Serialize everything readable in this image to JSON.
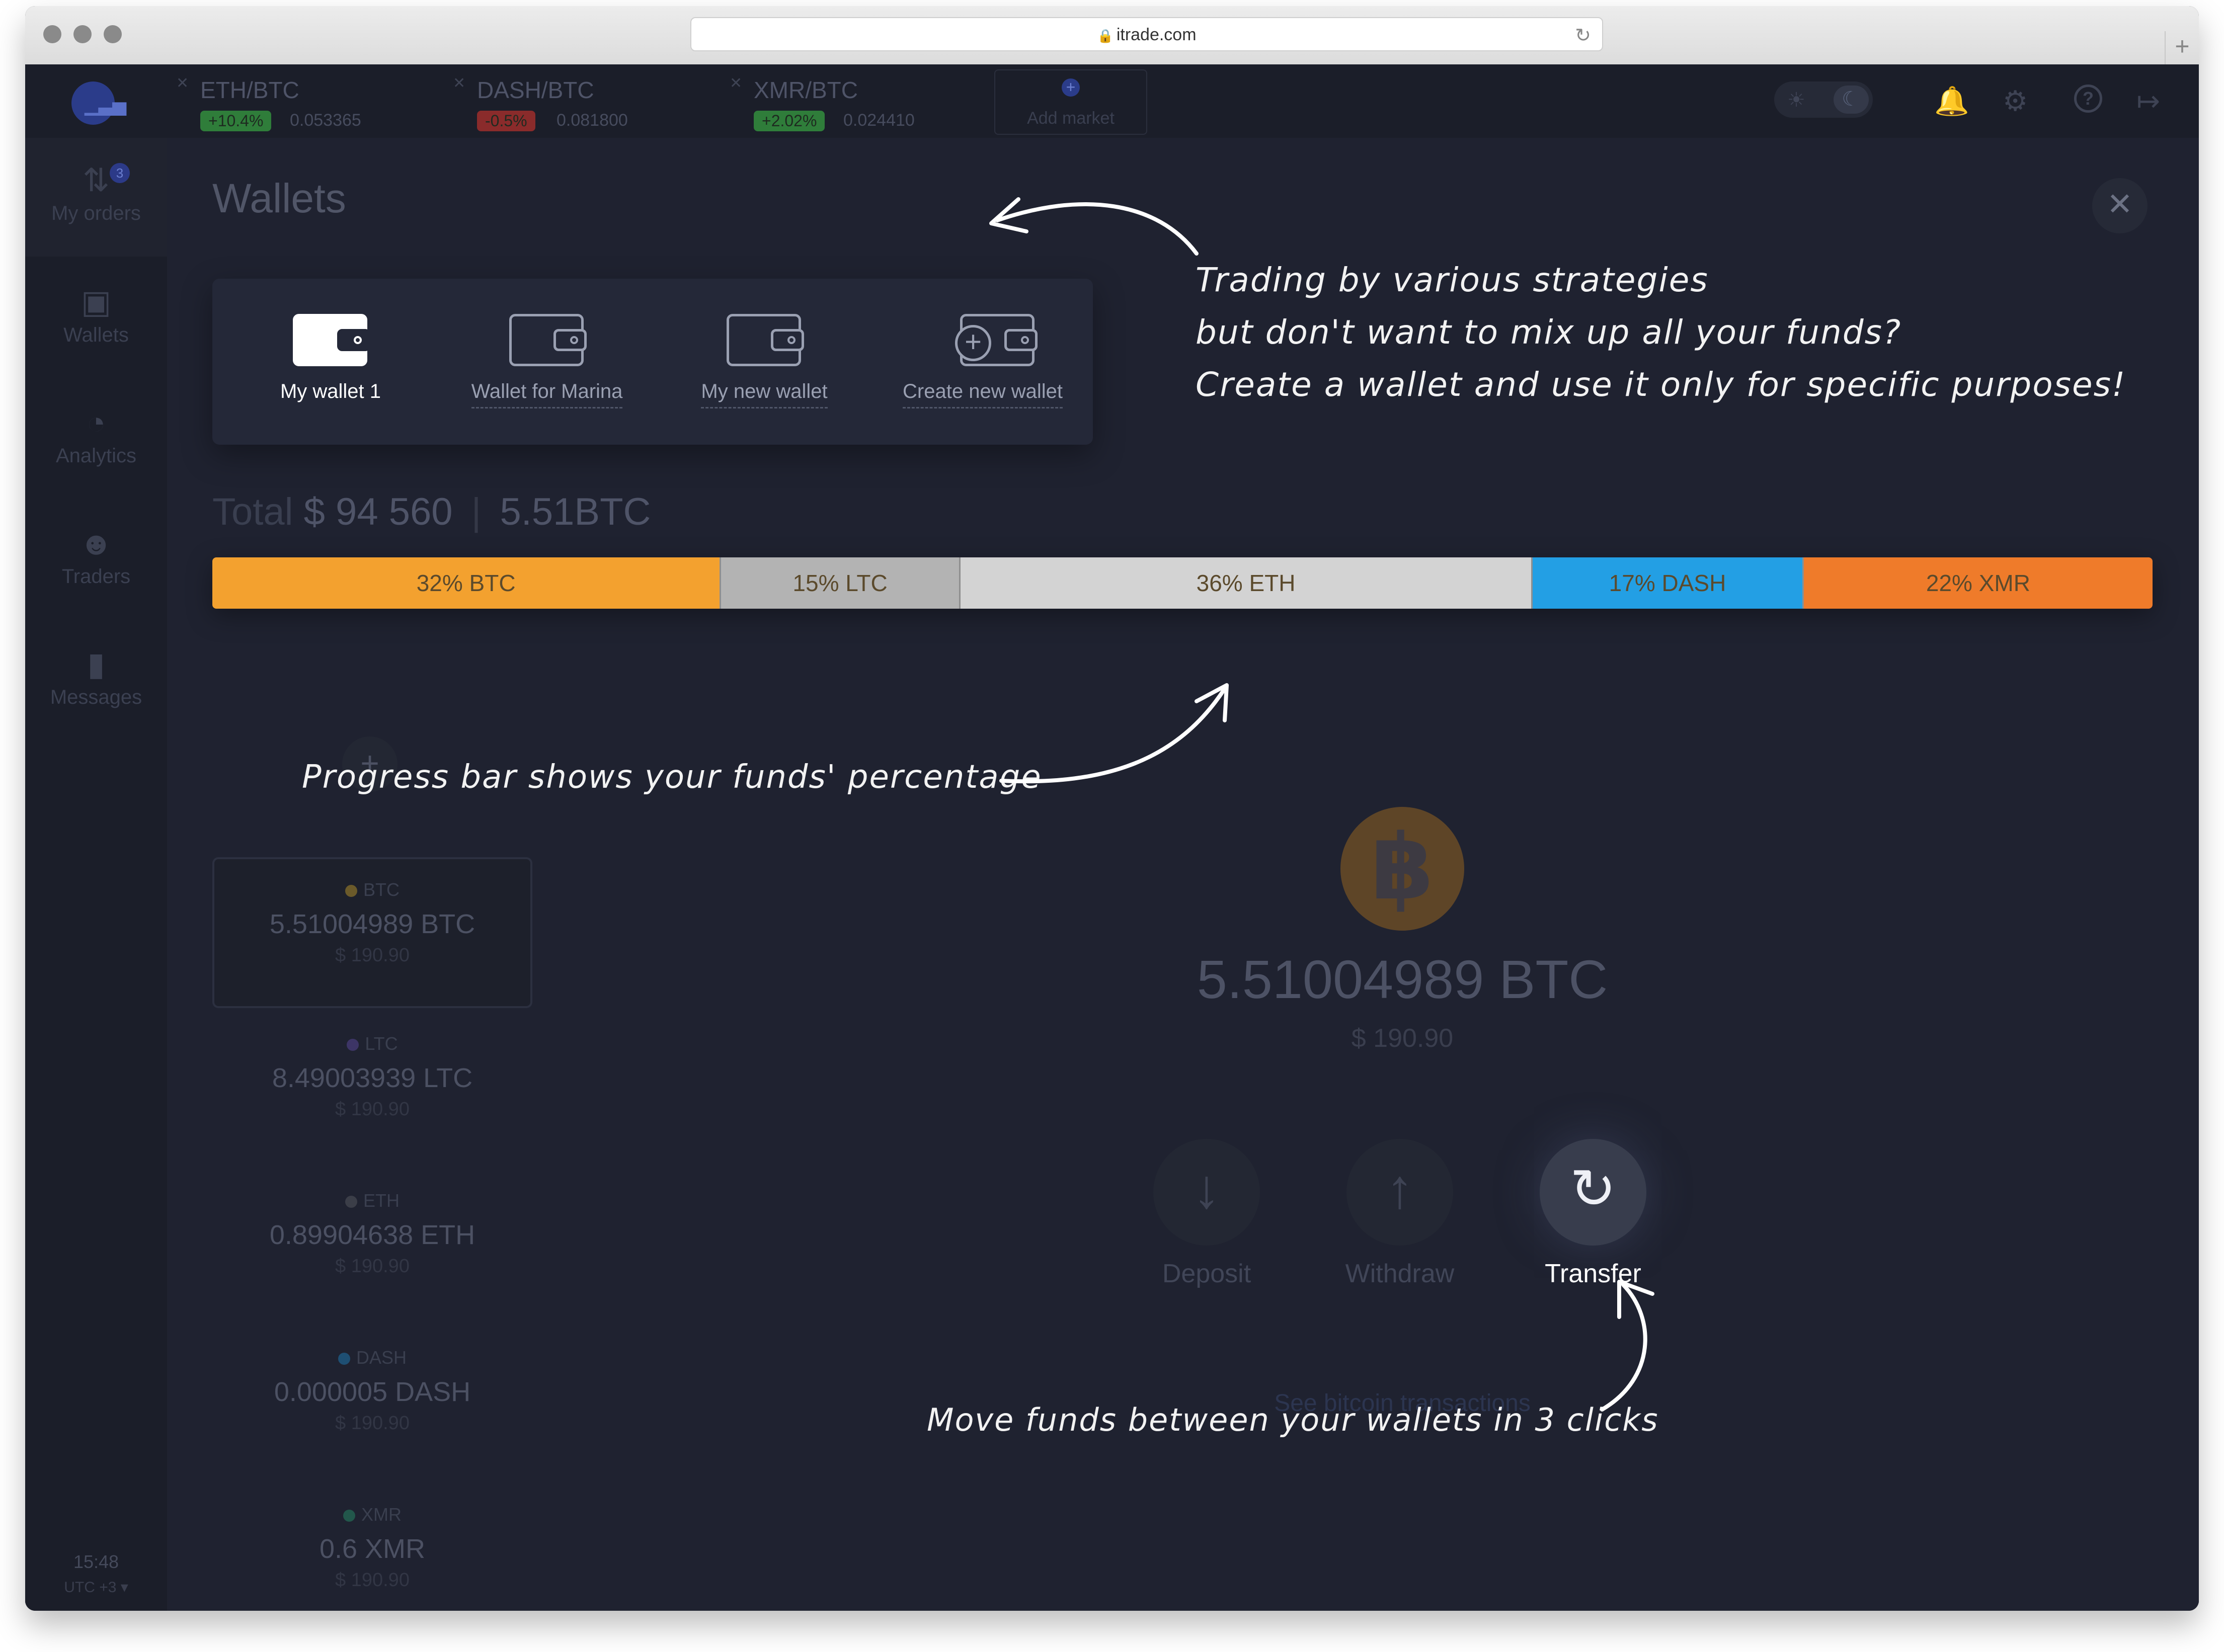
{
  "browser": {
    "url": "itrade.com"
  },
  "markets": [
    {
      "pair": "ETH/BTC",
      "change": "+10.4%",
      "price": "0.053365",
      "change_color": "#2f7d3a"
    },
    {
      "pair": "DASH/BTC",
      "change": "-0.5%",
      "price": "0.081800",
      "change_color": "#8a2b2b"
    },
    {
      "pair": "XMR/BTC",
      "change": "+2.02%",
      "price": "0.024410",
      "change_color": "#2f7d3a"
    }
  ],
  "add_market_label": "Add market",
  "sidebar": {
    "items": [
      {
        "label": "My orders",
        "icon": "arrows-updown-icon",
        "badge": "3"
      },
      {
        "label": "Wallets",
        "icon": "wallet-icon"
      },
      {
        "label": "Analytics",
        "icon": "pie-chart-icon"
      },
      {
        "label": "Traders",
        "icon": "users-icon"
      },
      {
        "label": "Messages",
        "icon": "chat-icon"
      }
    ],
    "time": "15:48",
    "timezone": "UTC +3 ▾"
  },
  "page": {
    "title": "Wallets"
  },
  "wallet_tabs": [
    {
      "label": "My wallet 1",
      "active": true
    },
    {
      "label": "Wallet for Marina"
    },
    {
      "label": "My new wallet"
    },
    {
      "label": "Create new wallet"
    }
  ],
  "total": {
    "label": "Total",
    "usd": "$ 94 560",
    "btc": "5.51BTC"
  },
  "progress": [
    {
      "label": "32% BTC",
      "percent": 32,
      "color": "#f3a12f"
    },
    {
      "label": "15% LTC",
      "percent": 15,
      "color": "#b3b3b3"
    },
    {
      "label": "36% ETH",
      "percent": 36,
      "color": "#d3d3d3"
    },
    {
      "label": "17% DASH",
      "percent": 17,
      "color": "#239fe4"
    },
    {
      "label": "22% XMR",
      "percent": 22,
      "color": "#ef7b2a"
    }
  ],
  "coins": [
    {
      "name": "BTC",
      "amount": "5.51004989 BTC",
      "usd": "$ 190.90",
      "dot": "#6b5a2a"
    },
    {
      "name": "LTC",
      "amount": "8.49003939 LTC",
      "usd": "$ 190.90",
      "dot": "#3d3566"
    },
    {
      "name": "ETH",
      "amount": "0.89904638 ETH",
      "usd": "$ 190.90",
      "dot": "#3b3e48"
    },
    {
      "name": "DASH",
      "amount": "0.000005 DASH",
      "usd": "$ 190.90",
      "dot": "#1e4f73"
    },
    {
      "name": "XMR",
      "amount": "0.6 XMR",
      "usd": "$ 190.90",
      "dot": "#22574b"
    }
  ],
  "selected": {
    "amount": "5.51004989 BTC",
    "usd": "$ 190.90",
    "icon": "bitcoin-icon"
  },
  "actions": [
    {
      "label": "Deposit",
      "icon": "arrow-down-icon"
    },
    {
      "label": "Withdraw",
      "icon": "arrow-up-icon"
    },
    {
      "label": "Transfer",
      "icon": "refresh-icon"
    }
  ],
  "see_transactions": "See bitcoin transactions",
  "annotations": {
    "wallets_lines": [
      "Trading by various strategies",
      "but don't want to mix up all your funds?",
      "Create a wallet and use it only for specific purposes!"
    ],
    "progress": "Progress bar shows your funds' percentage",
    "transfer": "Move funds between your wallets in 3 clicks"
  }
}
